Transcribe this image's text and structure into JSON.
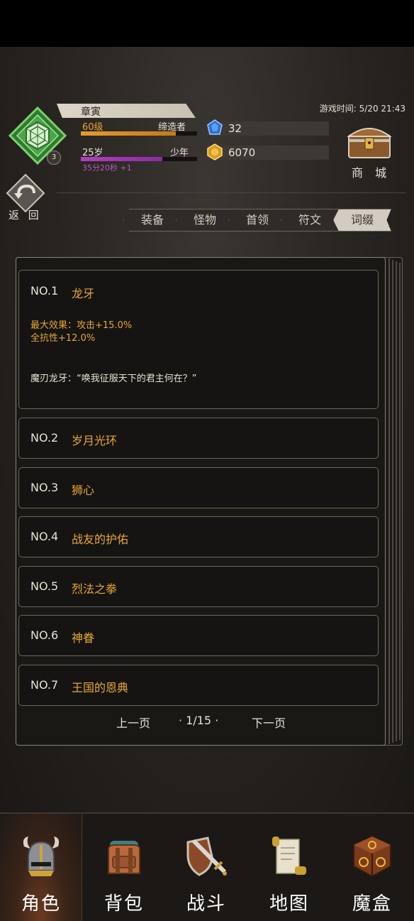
{
  "character": {
    "name": "章寅",
    "level": "60级",
    "title": "缔造者",
    "exp_progress": 0.82,
    "age": "25岁",
    "life_stage": "少年",
    "age_progress": 0.7,
    "timer": "35分20秒 +1",
    "avatar_level": "3",
    "avatar_icon": "green-crystal-emblem-icon"
  },
  "currency": {
    "gems": "32",
    "gold": "6070"
  },
  "game_time": "游戏时间: 5/20 21:43",
  "shop_label": "商 城",
  "back_label": "返 回",
  "tabs": [
    {
      "label": "装备",
      "active": false
    },
    {
      "label": "怪物",
      "active": false
    },
    {
      "label": "首领",
      "active": false
    },
    {
      "label": "符文",
      "active": false
    },
    {
      "label": "词缀",
      "active": true
    }
  ],
  "affixes": {
    "expanded": {
      "no": "NO.1",
      "name": "龙牙",
      "effect_line1": "最大效果：攻击+15.0%",
      "effect_line2": "全抗性+12.0%",
      "quote": "魔刃龙牙：“唤我征服天下的君主何在？”"
    },
    "items": [
      {
        "no": "NO.2",
        "name": "岁月光环"
      },
      {
        "no": "NO.3",
        "name": "狮心"
      },
      {
        "no": "NO.4",
        "name": "战友的护佑"
      },
      {
        "no": "NO.5",
        "name": "烈法之拳"
      },
      {
        "no": "NO.6",
        "name": "神眷"
      },
      {
        "no": "NO.7",
        "name": "王国的恩典"
      }
    ]
  },
  "pager": {
    "prev": "上一页",
    "current": "· 1/15 ·",
    "next": "下一页"
  },
  "nav": [
    {
      "label": "角色",
      "icon": "viking-helmet-icon",
      "active": true
    },
    {
      "label": "背包",
      "icon": "backpack-icon",
      "active": false
    },
    {
      "label": "战斗",
      "icon": "sword-shield-icon",
      "active": false
    },
    {
      "label": "地图",
      "icon": "scroll-map-icon",
      "active": false
    },
    {
      "label": "魔盒",
      "icon": "magic-box-icon",
      "active": false
    }
  ],
  "colors": {
    "accent_gold": "#e6a736",
    "exp_bar": "#e79a2c",
    "age_bar": "#b13fc1",
    "text": "#e8e2d6"
  }
}
